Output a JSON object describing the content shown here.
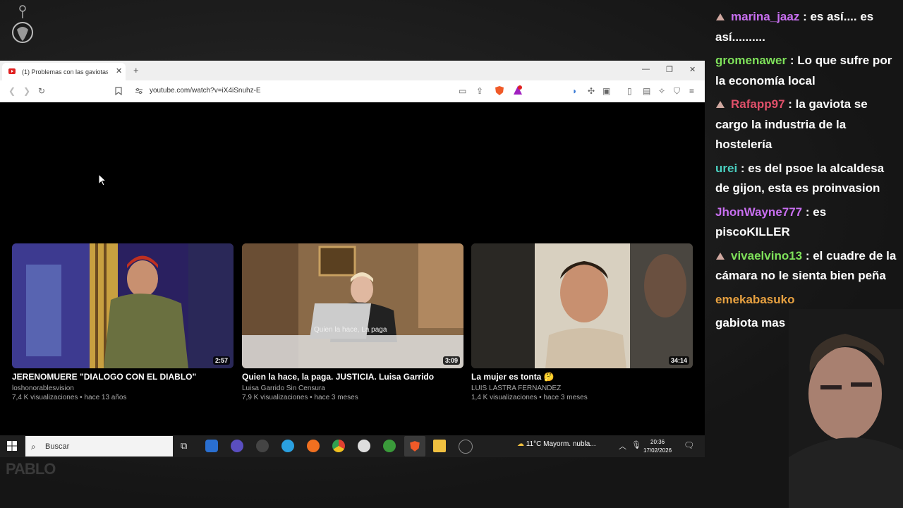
{
  "browser": {
    "tab_title": "(1) Problemas con las gaviotas -",
    "url": "youtube.com/watch?v=iX4iSnuhz-E",
    "new_tab_symbol": "+",
    "close_symbol": "✕"
  },
  "videos": [
    {
      "title": "JERENOMUERE \"DIALOGO CON EL DIABLO\"",
      "channel": "loshonorablesvision",
      "meta": "7,4 K visualizaciones • hace 13 años",
      "duration": "2:57"
    },
    {
      "title": "Quien la hace, la paga. JUSTICIA. Luisa Garrido",
      "channel": "Luisa Garrido Sin Censura",
      "meta": "7,9 K visualizaciones • hace 3 meses",
      "duration": "3:09",
      "overlay": "Quien la hace, La paga"
    },
    {
      "title": "La mujer es tonta 🤔",
      "channel": "LUIS LASTRA FERNANDEZ",
      "meta": "1,4 K visualizaciones • hace 3 meses",
      "duration": "34:14"
    }
  ],
  "taskbar": {
    "search_placeholder": "Buscar",
    "weather": "11°C  Mayorm. nubla...",
    "time": "20:36",
    "date": "17/02/2026"
  },
  "chat": [
    {
      "user": "marina_jaaz",
      "color": "#c86ff0",
      "text": " : es así.... es así..........",
      "badge": true
    },
    {
      "user": "gromenawer",
      "color": "#7ee05a",
      "text": " : Lo que sufre por la economía local",
      "badge": false
    },
    {
      "user": "Rafapp97",
      "color": "#e0506a",
      "text": " : la gaviota se cargo la industria de la hostelería",
      "badge": true
    },
    {
      "user": "urei",
      "color": "#4ad0c0",
      "text": " : es del psoe la alcaldesa de gijon, esta es proinvasion",
      "badge": false
    },
    {
      "user": "JhonWayne777",
      "color": "#c86ff0",
      "text": " : es piscoKILLER",
      "badge": false
    },
    {
      "user": "vivaelvino13",
      "color": "#7ee05a",
      "text": " : el cuadre de la cámara no le sienta bien peña",
      "badge": true
    },
    {
      "user": "emekabasuko",
      "color": "#e6a040",
      "text": "",
      "badge": false
    },
    {
      "user": "",
      "color": "#ffffff",
      "text": "gabiota mas",
      "badge": false
    }
  ],
  "colors": {
    "youtube_red": "#e02020",
    "taskbar": "#1f1f1f"
  }
}
